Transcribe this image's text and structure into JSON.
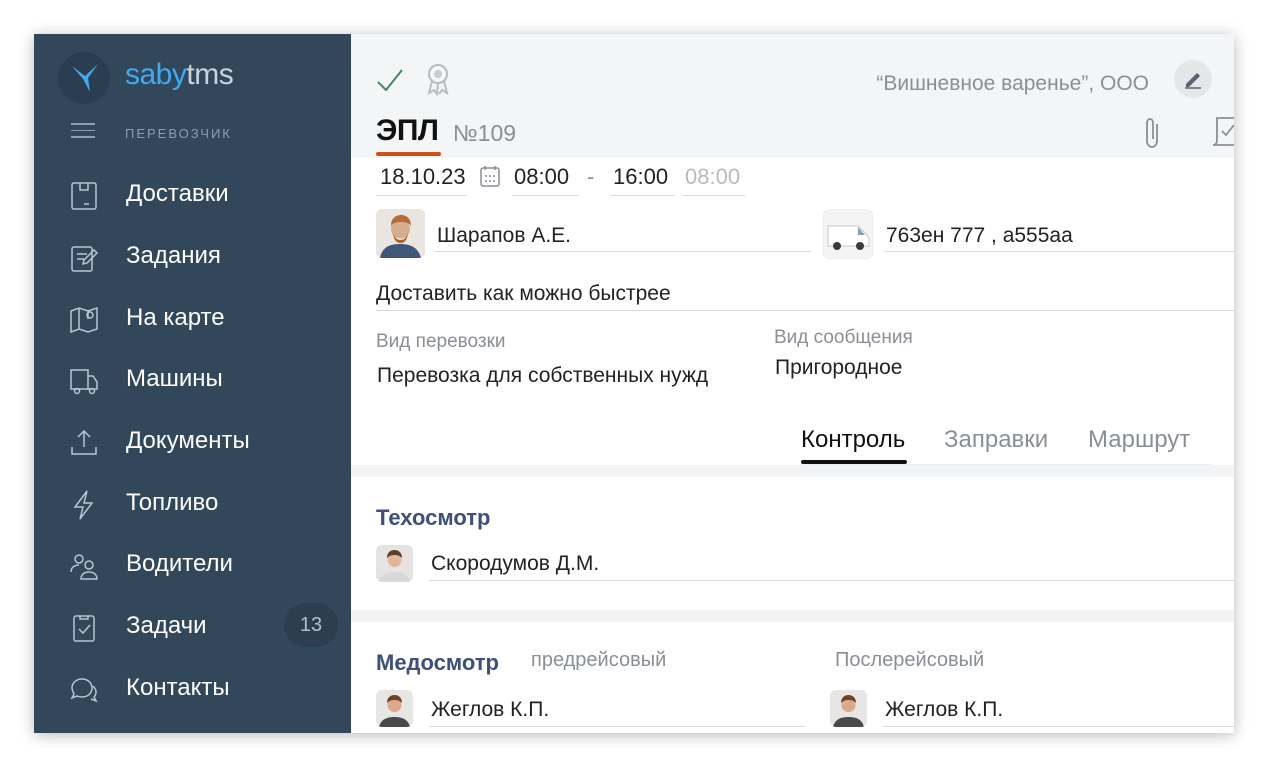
{
  "app": {
    "brand_part1": "saby",
    "brand_part2": "tms",
    "role": "ПЕРЕВОЗЧИК"
  },
  "sidebar": {
    "items": [
      {
        "label": "Доставки",
        "icon": "box-icon"
      },
      {
        "label": "Задания",
        "icon": "task-edit-icon"
      },
      {
        "label": "На карте",
        "icon": "map-icon"
      },
      {
        "label": "Машины",
        "icon": "truck-icon"
      },
      {
        "label": "Документы",
        "icon": "upload-icon"
      },
      {
        "label": "Топливо",
        "icon": "lightning-icon"
      },
      {
        "label": "Водители",
        "icon": "people-icon"
      },
      {
        "label": "Задачи",
        "icon": "clipboard-check-icon",
        "badge": "13"
      },
      {
        "label": "Контакты",
        "icon": "chat-icon"
      }
    ]
  },
  "header": {
    "company": "“Вишневное варенье”, ООО",
    "doc_type": "ЭПЛ",
    "doc_number": "№109"
  },
  "form": {
    "date": "18.10.23",
    "time_from": "08:00",
    "time_dash": "-",
    "time_to": "16:00",
    "time_extra": "08:00",
    "driver": "Шарапов А.Е.",
    "vehicle": "763ен 777 , а555аа",
    "comment": "Доставить как можно быстрее",
    "transport_type_label": "Вид перевозки",
    "transport_type_value": "Перевозка для собственных нужд",
    "message_type_label": "Вид сообщения",
    "message_type_value": "Пригородное"
  },
  "tabs": [
    {
      "label": "Контроль",
      "active": true
    },
    {
      "label": "Заправки",
      "active": false
    },
    {
      "label": "Маршрут",
      "active": false
    }
  ],
  "inspection": {
    "title": "Техосмотр",
    "person": "Скородумов Д.М."
  },
  "medical": {
    "title": "Медосмотр",
    "pre_label": "предрейсовый",
    "post_label": "Послерейсовый",
    "pre_person": "Жеглов К.П.",
    "post_person": "Жеглов К.П."
  },
  "colors": {
    "sidebar_bg": "#33475b",
    "accent_blue": "#41a9ee",
    "title_underline": "#d24e1b",
    "check_green": "#3f8a5c",
    "section_title": "#3d4f7a"
  }
}
